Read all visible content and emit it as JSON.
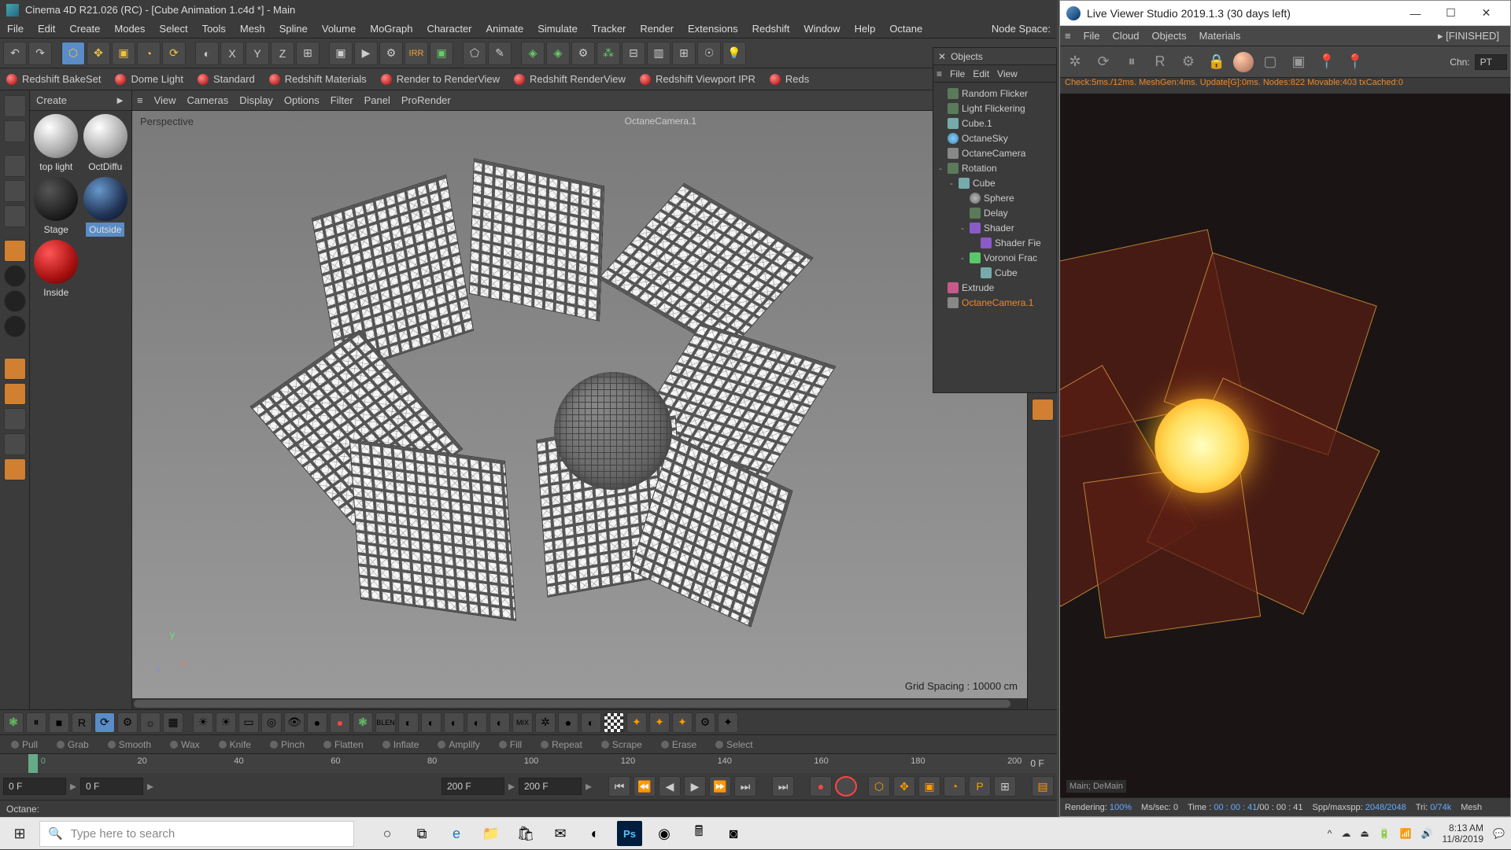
{
  "c4d": {
    "title": "Cinema 4D R21.026 (RC) - [Cube Animation 1.c4d *] - Main",
    "menu": [
      "File",
      "Edit",
      "Create",
      "Modes",
      "Select",
      "Tools",
      "Mesh",
      "Spline",
      "Volume",
      "MoGraph",
      "Character",
      "Animate",
      "Simulate",
      "Tracker",
      "Render",
      "Extensions",
      "Redshift",
      "Window",
      "Help",
      "Octane"
    ],
    "node_space": "Node Space:",
    "plugins": [
      "Redshift BakeSet",
      "Dome Light",
      "Standard",
      "Redshift Materials",
      "Render to RenderView",
      "Redshift RenderView",
      "Redshift Viewport IPR",
      "Reds"
    ],
    "materials": {
      "menu": "Create",
      "arrow": "►",
      "items": [
        {
          "label": "top light",
          "ball": "white"
        },
        {
          "label": "OctDiffu",
          "ball": "white"
        },
        {
          "label": "Stage",
          "ball": "dark"
        },
        {
          "label": "Outside",
          "ball": "navy",
          "sel": true
        },
        {
          "label": "Inside",
          "ball": "red"
        }
      ]
    },
    "viewport": {
      "menu": [
        "View",
        "Cameras",
        "Display",
        "Options",
        "Filter",
        "Panel",
        "ProRender"
      ],
      "tag": "Perspective",
      "cam": "OctaneCamera.1",
      "grid": "Grid Spacing : 10000 cm"
    },
    "sculpt": [
      "Pull",
      "Grab",
      "Smooth",
      "Wax",
      "Knife",
      "Pinch",
      "Flatten",
      "Inflate",
      "Amplify",
      "Fill",
      "Repeat",
      "Scrape",
      "Erase",
      "Select"
    ],
    "timeline": {
      "ticks": [
        "0",
        "20",
        "40",
        "60",
        "80",
        "100",
        "120",
        "140",
        "160",
        "180",
        "200"
      ],
      "end": "0 F",
      "f1": "0 F",
      "f2": "0 F",
      "f3": "200 F",
      "f4": "200 F"
    },
    "status": "Octane:"
  },
  "objects": {
    "title": "Objects",
    "menu": [
      "File",
      "Edit",
      "View"
    ],
    "tree": [
      {
        "ind": 0,
        "ico": "null",
        "label": "Random Flicker"
      },
      {
        "ind": 0,
        "ico": "null",
        "label": "Light Flickering"
      },
      {
        "ind": 0,
        "ico": "cube",
        "label": "Cube.1"
      },
      {
        "ind": 0,
        "ico": "sky",
        "label": "OctaneSky"
      },
      {
        "ind": 0,
        "ico": "cam",
        "label": "OctaneCamera"
      },
      {
        "ind": 0,
        "ico": "null",
        "label": "Rotation",
        "exp": "-"
      },
      {
        "ind": 1,
        "ico": "cube",
        "label": "Cube",
        "exp": "-"
      },
      {
        "ind": 2,
        "ico": "sph",
        "label": "Sphere"
      },
      {
        "ind": 2,
        "ico": "null",
        "label": "Delay"
      },
      {
        "ind": 2,
        "ico": "field",
        "label": "Shader",
        "exp": "-"
      },
      {
        "ind": 3,
        "ico": "field",
        "label": "Shader Fie"
      },
      {
        "ind": 2,
        "ico": "frac",
        "label": "Voronoi Frac",
        "exp": "-"
      },
      {
        "ind": 3,
        "ico": "cube",
        "label": "Cube"
      },
      {
        "ind": 0,
        "ico": "ext",
        "label": "Extrude"
      },
      {
        "ind": 0,
        "ico": "cam",
        "label": "OctaneCamera.1",
        "sel": true
      }
    ]
  },
  "live": {
    "title": "Live Viewer Studio 2019.1.3 (30 days left)",
    "menu": [
      "File",
      "Cloud",
      "Objects",
      "Materials"
    ],
    "fin": "[FINISHED]",
    "chn": "Chn:",
    "chn_val": "PT",
    "stats": "Check:5ms./12ms. MeshGen:4ms. Update[G]:0ms. Nodes:822 Movable:403 txCached:0",
    "render_tag": "Main; DeMain",
    "status": {
      "rendering": "Rendering:",
      "pct": "100%",
      "ms": "Ms/sec: 0",
      "time": "Time : 00 : 00 : 41/00 : 00 : 41",
      "spp": "Spp/maxspp: 2048/2048",
      "tri": "Tri: 0/74k",
      "mesh": "Mesh"
    }
  },
  "taskbar": {
    "search": "Type here to search",
    "time": "8:13 AM",
    "date": "11/8/2019"
  }
}
